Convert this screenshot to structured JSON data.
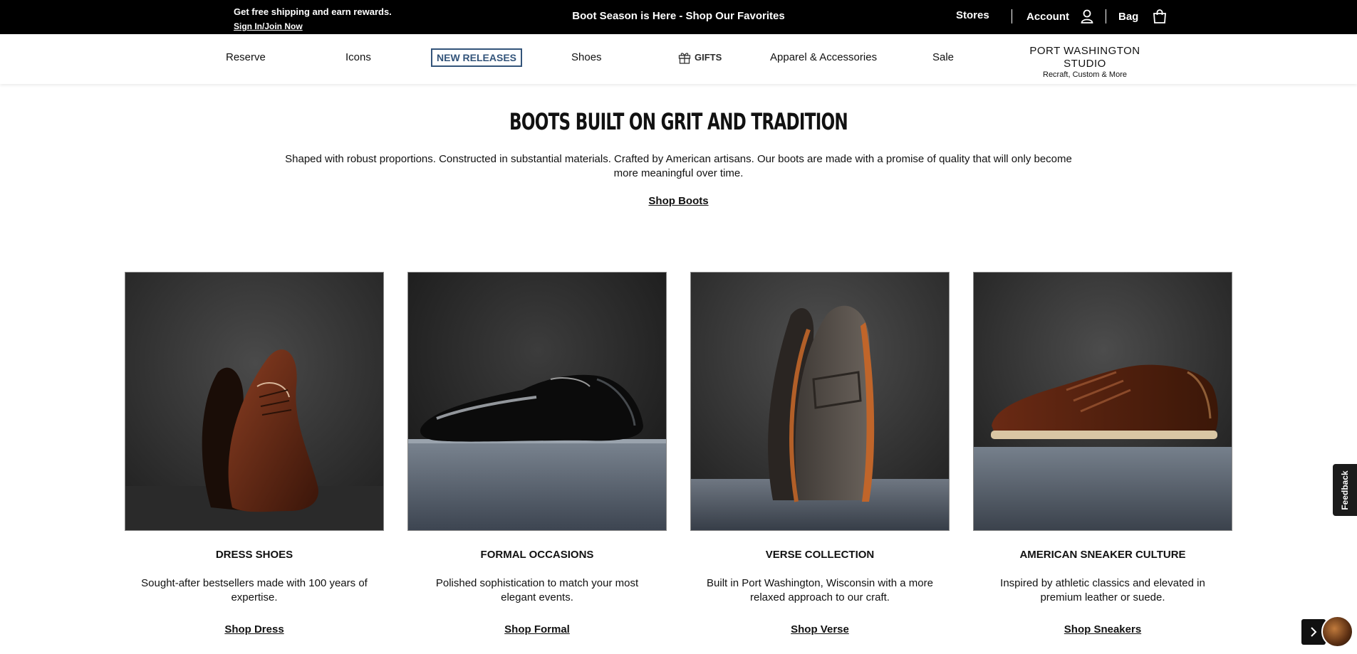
{
  "topbar": {
    "promo_text": "Get free shipping and earn rewards.",
    "promo_link": "Sign In/Join Now",
    "announcement": "Boot Season is Here - Shop Our Favorites",
    "stores": "Stores",
    "account": "Account",
    "bag": "Bag",
    "icons": {
      "account": "user-icon",
      "bag": "shopping-bag-icon"
    }
  },
  "nav": {
    "reserve": "Reserve",
    "icons": "Icons",
    "new_releases": "NEW RELEASES",
    "shoes": "Shoes",
    "gifts": "GIFTS",
    "apparel": "Apparel & Accessories",
    "sale": "Sale",
    "studio_title": "PORT WASHINGTON STUDIO",
    "studio_subtitle": "Recraft, Custom & More",
    "gift_icon": "gift-icon",
    "accent_color": "#33547a"
  },
  "hero": {
    "title": "BOOTS BUILT ON GRIT AND TRADITION",
    "copy": "Shaped with robust proportions. Constructed in substantial materials. Crafted by American artisans. Our boots are made with a promise of quality that will only become more meaningful over time.",
    "link": "Shop Boots"
  },
  "cards": [
    {
      "title": "DRESS SHOES",
      "desc": "Sought-after bestsellers made with 100 years of expertise.",
      "link": "Shop Dress"
    },
    {
      "title": "FORMAL OCCASIONS",
      "desc": "Polished sophistication to match your most elegant events.",
      "link": "Shop Formal"
    },
    {
      "title": "VERSE COLLECTION",
      "desc": "Built in Port Washington, Wisconsin with a more relaxed approach to our craft.",
      "link": "Shop Verse"
    },
    {
      "title": "AMERICAN SNEAKER CULTURE",
      "desc": "Inspired by athletic classics and elevated in premium leather or suede.",
      "link": "Shop Sneakers"
    }
  ],
  "feedback": "Feedback",
  "chat": {
    "arrow_icon": "chevron-right-icon",
    "avatar_icon": "chat-avatar"
  }
}
